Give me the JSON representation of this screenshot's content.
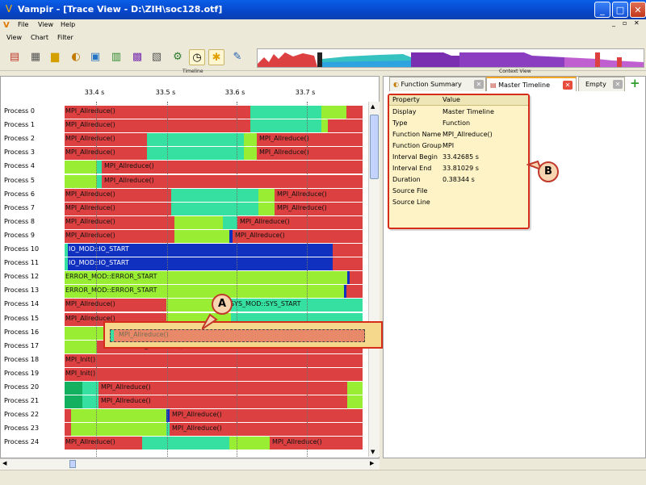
{
  "window": {
    "title": "Vampir - [Trace View - D:\\ZIH\\soc128.otf]",
    "min_label": "_",
    "max_label": "□",
    "close_label": "✕"
  },
  "menu_main": {
    "items": [
      "File",
      "View",
      "Help"
    ]
  },
  "menu_chart": {
    "items": [
      "View",
      "Chart",
      "Filter"
    ]
  },
  "inner_window_buttons": [
    "_",
    "▫",
    "✕"
  ],
  "toolbar": {
    "icons": [
      "master-timeline-icon",
      "process-timeline-icon",
      "counter-timeline-icon",
      "function-summary-icon",
      "message-summary-icon",
      "process-summary-icon",
      "communication-matrix-icon",
      "io-summary-icon",
      "call-tree-icon",
      "zoom-toolbar-icon",
      "context-view-icon",
      "marker-view-icon"
    ]
  },
  "sections": {
    "timeline": "Timeline",
    "context_view": "Context View"
  },
  "timeline": {
    "ticks": [
      "33.4 s",
      "33.5 s",
      "33.6 s",
      "33.7 s"
    ],
    "processes": [
      {
        "name": "Process 0",
        "segs": [
          [
            0,
            230,
            "#dc4040"
          ],
          [
            230,
            318,
            "#36e0a0"
          ],
          [
            318,
            349,
            "#99ee33"
          ],
          [
            349,
            369,
            "#dc4040"
          ]
        ],
        "label": "MPI_Allreduce()",
        "label_at": 0
      },
      {
        "name": "Process 1",
        "segs": [
          [
            0,
            230,
            "#dc4040"
          ],
          [
            230,
            318,
            "#36e0a0"
          ],
          [
            318,
            326,
            "#99ee33"
          ],
          [
            326,
            369,
            "#dc4040"
          ]
        ],
        "label": "MPI_Allreduce()",
        "label_at": 0
      },
      {
        "name": "Process 2",
        "segs": [
          [
            0,
            102,
            "#dc4040"
          ],
          [
            102,
            222,
            "#36e0a0"
          ],
          [
            222,
            238,
            "#99ee33"
          ],
          [
            238,
            369,
            "#dc4040"
          ]
        ],
        "label": "MPI_Allreduce()",
        "label_at": 0,
        "label2": "MPI_Allreduce()",
        "label2_at": 240
      },
      {
        "name": "Process 3",
        "segs": [
          [
            0,
            102,
            "#dc4040"
          ],
          [
            102,
            222,
            "#36e0a0"
          ],
          [
            222,
            238,
            "#99ee33"
          ],
          [
            238,
            369,
            "#dc4040"
          ]
        ],
        "label": "MPI_Allreduce()",
        "label_at": 0,
        "label2": "MPI_Allreduce()",
        "label2_at": 240
      },
      {
        "name": "Process 4",
        "segs": [
          [
            0,
            40,
            "#99ee33"
          ],
          [
            40,
            46,
            "#36e0a0"
          ],
          [
            46,
            369,
            "#dc4040"
          ]
        ],
        "label": "MPI_Allreduce()",
        "label_at": 48
      },
      {
        "name": "Process 5",
        "segs": [
          [
            0,
            40,
            "#99ee33"
          ],
          [
            40,
            46,
            "#36e0a0"
          ],
          [
            46,
            369,
            "#dc4040"
          ]
        ],
        "label": "MPI_Allreduce()",
        "label_at": 48
      },
      {
        "name": "Process 6",
        "segs": [
          [
            0,
            132,
            "#dc4040"
          ],
          [
            132,
            240,
            "#36e0a0"
          ],
          [
            240,
            260,
            "#99ee33"
          ],
          [
            260,
            369,
            "#dc4040"
          ]
        ],
        "label": "MPI_Allreduce()",
        "label_at": 0,
        "label2": "MPI_Allreduce()",
        "label2_at": 262
      },
      {
        "name": "Process 7",
        "segs": [
          [
            0,
            132,
            "#dc4040"
          ],
          [
            132,
            240,
            "#36e0a0"
          ],
          [
            240,
            260,
            "#99ee33"
          ],
          [
            260,
            369,
            "#dc4040"
          ]
        ],
        "label": "MPI_Allreduce()",
        "label_at": 0,
        "label2": "MPI_Allreduce()",
        "label2_at": 262
      },
      {
        "name": "Process 8",
        "segs": [
          [
            0,
            136,
            "#dc4040"
          ],
          [
            136,
            196,
            "#99ee33"
          ],
          [
            196,
            214,
            "#36e0a0"
          ],
          [
            214,
            369,
            "#dc4040"
          ]
        ],
        "label": "MPI_Allreduce()",
        "label_at": 0,
        "label2": "MPI_Allreduce()",
        "label2_at": 216
      },
      {
        "name": "Process 9",
        "segs": [
          [
            0,
            136,
            "#dc4040"
          ],
          [
            136,
            204,
            "#99ee33"
          ],
          [
            204,
            208,
            "#1030c0"
          ],
          [
            208,
            369,
            "#dc4040"
          ]
        ],
        "label": "MPI_Allreduce()",
        "label_at": 0,
        "label2": "MPI_Allreduce()",
        "label2_at": 210
      },
      {
        "name": "Process 10",
        "segs": [
          [
            0,
            4,
            "#36e0a0"
          ],
          [
            4,
            332,
            "#1030c0"
          ],
          [
            332,
            369,
            "#dc4040"
          ]
        ],
        "label": "IO_MOD::IO_START",
        "label_at": 4,
        "light": true
      },
      {
        "name": "Process 11",
        "segs": [
          [
            0,
            4,
            "#36e0a0"
          ],
          [
            4,
            332,
            "#1030c0"
          ],
          [
            332,
            369,
            "#dc4040"
          ]
        ],
        "label": "IO_MOD::IO_START",
        "label_at": 4,
        "light": true
      },
      {
        "name": "Process 12",
        "segs": [
          [
            0,
            350,
            "#99ee33"
          ],
          [
            350,
            353,
            "#1030c0"
          ],
          [
            353,
            369,
            "#dc4040"
          ]
        ],
        "label": "ERROR_MOD::ERROR_START",
        "label_at": 0
      },
      {
        "name": "Process 13",
        "segs": [
          [
            0,
            346,
            "#99ee33"
          ],
          [
            346,
            349,
            "#1030c0"
          ],
          [
            349,
            369,
            "#dc4040"
          ]
        ],
        "label": "ERROR_MOD::ERROR_START",
        "label_at": 0
      },
      {
        "name": "Process 14",
        "segs": [
          [
            0,
            126,
            "#dc4040"
          ],
          [
            126,
            206,
            "#99ee33"
          ],
          [
            206,
            369,
            "#36e0a0"
          ]
        ],
        "label": "MPI_Allreduce()",
        "label_at": 0,
        "label2": "SYS_MOD::SYS_START",
        "label2_at": 204
      },
      {
        "name": "Process 15",
        "segs": [
          [
            0,
            126,
            "#dc4040"
          ],
          [
            126,
            206,
            "#99ee33"
          ],
          [
            206,
            369,
            "#36e0a0"
          ]
        ],
        "label": "MPI_Allreduce()",
        "label_at": 0
      },
      {
        "name": "Process 16",
        "segs": [
          [
            0,
            369,
            "#99ee33"
          ]
        ],
        "label": "",
        "label_at": 0
      },
      {
        "name": "Process 17",
        "segs": [
          [
            0,
            40,
            "#99ee33"
          ],
          [
            40,
            369,
            "#dc4040"
          ]
        ],
        "label": "MPI_Allreduce()",
        "label_at": 84
      },
      {
        "name": "Process 18",
        "segs": [
          [
            0,
            369,
            "#dc4040"
          ]
        ],
        "label": "MPI_Init()",
        "label_at": 0
      },
      {
        "name": "Process 19",
        "segs": [
          [
            0,
            369,
            "#dc4040"
          ]
        ],
        "label": "MPI_Init()",
        "label_at": 0
      },
      {
        "name": "Process 20",
        "segs": [
          [
            0,
            22,
            "#13b060"
          ],
          [
            22,
            42,
            "#36e0a0"
          ],
          [
            42,
            350,
            "#dc4040"
          ],
          [
            350,
            369,
            "#99ee33"
          ]
        ],
        "label": "MPI_Allreduce()",
        "label_at": 44
      },
      {
        "name": "Process 21",
        "segs": [
          [
            0,
            22,
            "#13b060"
          ],
          [
            22,
            42,
            "#36e0a0"
          ],
          [
            42,
            350,
            "#dc4040"
          ],
          [
            350,
            369,
            "#99ee33"
          ]
        ],
        "label": "MPI_Allreduce()",
        "label_at": 44
      },
      {
        "name": "Process 22",
        "segs": [
          [
            0,
            8,
            "#dc4040"
          ],
          [
            8,
            126,
            "#99ee33"
          ],
          [
            126,
            130,
            "#1030c0"
          ],
          [
            130,
            369,
            "#dc4040"
          ]
        ],
        "label": "MPI_Allreduce()",
        "label_at": 132
      },
      {
        "name": "Process 23",
        "segs": [
          [
            0,
            8,
            "#dc4040"
          ],
          [
            8,
            126,
            "#99ee33"
          ],
          [
            126,
            130,
            "#36e0a0"
          ],
          [
            130,
            369,
            "#dc4040"
          ]
        ],
        "label": "MPI_Allreduce()",
        "label_at": 132
      },
      {
        "name": "Process 24",
        "segs": [
          [
            0,
            96,
            "#dc4040"
          ],
          [
            96,
            204,
            "#36e0a0"
          ],
          [
            204,
            254,
            "#99ee33"
          ],
          [
            254,
            369,
            "#dc4040"
          ]
        ],
        "label": "MPI_Allreduce()",
        "label_at": 0,
        "label2": "MPI_Allreduce()",
        "label2_at": 256
      }
    ]
  },
  "hover_popup": {
    "label": "MPI_Allreduce()"
  },
  "callouts": {
    "a": "A",
    "b": "B"
  },
  "context_view": {
    "tabs": [
      {
        "label": "Function Summary",
        "icon": "pie-chart-icon"
      },
      {
        "label": "Master Timeline",
        "icon": "timeline-icon"
      },
      {
        "label": "Empty",
        "icon": ""
      }
    ],
    "add_tab": "+",
    "table_header": {
      "property": "Property",
      "value": "Value"
    },
    "rows": [
      {
        "property": "Display",
        "value": "Master Timeline"
      },
      {
        "property": "Type",
        "value": "Function"
      },
      {
        "property": "Function Name",
        "value": "MPI_Allreduce()"
      },
      {
        "property": "Function Group",
        "value": "MPI"
      },
      {
        "property": "Interval Begin",
        "value": "33.42685 s"
      },
      {
        "property": "Interval End",
        "value": "33.81029 s"
      },
      {
        "property": "Duration",
        "value": "0.38344 s"
      },
      {
        "property": "Source File",
        "value": ""
      },
      {
        "property": "Source Line",
        "value": ""
      }
    ]
  },
  "colors": {
    "mpi": "#dc4040",
    "application": "#99ee33",
    "sys": "#36e0a0",
    "io": "#1030c0",
    "callout_border": "#d62c1a"
  }
}
